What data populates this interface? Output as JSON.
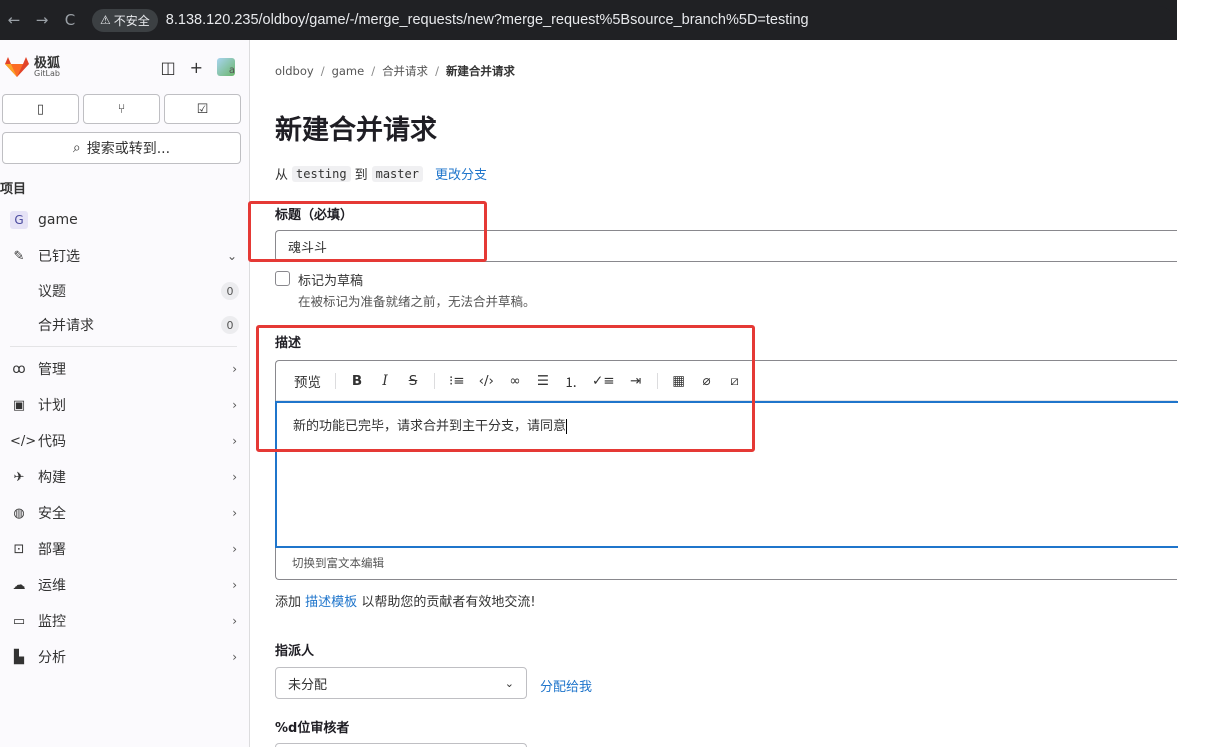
{
  "browser": {
    "back": "←",
    "forward": "→",
    "reload": "C",
    "insecure_label": "不安全",
    "url": "8.138.120.235/oldboy/game/-/merge_requests/new?merge_request%5Bsource_branch%5D=testing"
  },
  "sidebar": {
    "logo_title": "极狐",
    "logo_sub": "GitLab",
    "avatar_alt": "a",
    "search_label": "搜索或转到...",
    "section_title": "项目",
    "project": {
      "initial": "G",
      "name": "game"
    },
    "pinned": {
      "label": "已钉选",
      "items": [
        {
          "label": "议题",
          "count": "0"
        },
        {
          "label": "合并请求",
          "count": "0"
        }
      ]
    },
    "nav": [
      {
        "label": "管理",
        "icon": "users-icon"
      },
      {
        "label": "计划",
        "icon": "calendar-icon"
      },
      {
        "label": "代码",
        "icon": "code-icon"
      },
      {
        "label": "构建",
        "icon": "rocket-icon"
      },
      {
        "label": "安全",
        "icon": "shield-icon"
      },
      {
        "label": "部署",
        "icon": "deploy-icon"
      },
      {
        "label": "运维",
        "icon": "cloud-icon"
      },
      {
        "label": "监控",
        "icon": "monitor-icon"
      },
      {
        "label": "分析",
        "icon": "chart-icon"
      }
    ]
  },
  "breadcrumb": {
    "items": [
      "oldboy",
      "game",
      "合并请求"
    ],
    "current": "新建合并请求"
  },
  "page": {
    "title": "新建合并请求",
    "from": "从",
    "source": "testing",
    "to": "到",
    "target": "master",
    "change_branches": "更改分支",
    "title_label": "标题（必填）",
    "title_value": "魂斗斗",
    "draft_label": "标记为草稿",
    "draft_help": "在被标记为准备就绪之前，无法合并草稿。",
    "desc_label": "描述",
    "preview": "预览",
    "desc_value": "新的功能已完毕，请求合并到主干分支，请同意",
    "switch_rich": "切换到富文本编辑",
    "tmpl_prefix": "添加",
    "tmpl_link": "描述模板",
    "tmpl_suffix": "以帮助您的贡献者有效地交流!",
    "assignee_label": "指派人",
    "assignee_value": "未分配",
    "assign_me": "分配给我",
    "reviewer_label": "%d位审核者"
  },
  "colors": {
    "highlight": "#e53935",
    "link": "#1f75cb",
    "focus": "#1f75cb"
  }
}
